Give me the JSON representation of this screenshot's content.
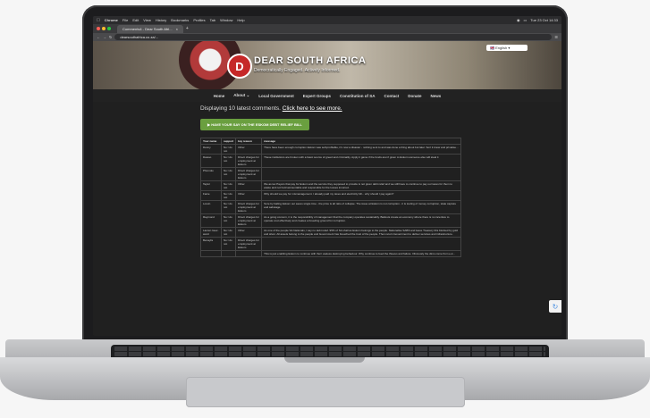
{
  "mac_menubar": {
    "app": "Chrome",
    "items": [
      "File",
      "Edit",
      "View",
      "History",
      "Bookmarks",
      "Profiles",
      "Tab",
      "Window",
      "Help"
    ],
    "clock": "Tue 23 Oct 14:33"
  },
  "browser": {
    "tab_title": "Comments4 - Dear South Afri...",
    "url": "dearsouthafrica.co.za/..."
  },
  "site": {
    "logo_letter": "D",
    "title": "DEAR SOUTH AFRICA",
    "tagline": "Democratically Engaged. Actively Informed.",
    "language": "English"
  },
  "nav": {
    "items": [
      "Home",
      "About ⌄",
      "Local Government",
      "Expert Groups",
      "Constitution of SA",
      "Contact",
      "Donate",
      "News"
    ]
  },
  "latest": {
    "text": "Displaying 10 latest comments.",
    "link": "Click here to see more."
  },
  "cta": {
    "label": "HAVE YOUR SAY ON THE ESKOM DEBT RELIEF BILL"
  },
  "table": {
    "headers": [
      "Your name",
      "support",
      "key reason",
      "message"
    ],
    "rows": [
      [
        "Danny",
        "No I do not",
        "Other",
        "There have been enough corruption Eskom was self-profitable, it's now a disaster - nothing sent to and was done a thing about but later. Sort it know and privatise..."
      ],
      [
        "Dawoo",
        "No I do not",
        "Direct charges for employment at Eskom",
        "These institutions are broken with a basic source of greed and criminality. Apply it game if the funds aren't given to Eskom someone else will steal it"
      ],
      [
        "Phomolo",
        "No I do not",
        "Direct charges for employment at Eskom",
        ""
      ],
      [
        "Taylor",
        "No I do not",
        "Other",
        "We as tax Payers that pay for Eskom and the service they supposed to provide is not given debt relief and we still have to continue to pay our taxes for them to waste and not hold accountable and responsible for the losses incurred."
      ],
      [
        "Fanie",
        "No I do not",
        "Other",
        "Why should we pay for mismanagement. I already paid my taxes and electricity bill... why should I pay again?"
      ],
      [
        "Lorein",
        "No I do not",
        "Direct charges for employment at Eskom",
        "Sure by bailing Eskom out saves single time - the price is all ratio of collapse. The issue at Eskom is not corruption - it is tooling of money corruption, state capture and sabotage."
      ],
      [
        "Raymond",
        "No I do not",
        "Direct charges for employment at Eskom",
        "As a going concern, it is the responsibility of management that the company operates sustainably. Bailouts create an economy where there is no incentive to operate cost effectively and creates a breeding ground for corruption."
      ],
      [
        "Lauren louw-ward",
        "No I do not",
        "Other",
        "As one of the people SA Nationals, I say no debt relief. 95% of SA shall as Eskom belongs to the people. Nationalise SABS and leave Treasury this blocked by gold and silver. All assets belong to the people and Government has breached the trust of the people. Then return Government to deliver services and infrastructure."
      ],
      [
        "Benayfa",
        "No I do not",
        "Direct charges for employment at Eskom",
        ""
      ],
      [
        "",
        "",
        "",
        "This is just enabling Eskom to continue with their useless destroying behaviour. Why continue to feed the thieves and failure. Obviously the dims come from e-k..."
      ]
    ]
  }
}
